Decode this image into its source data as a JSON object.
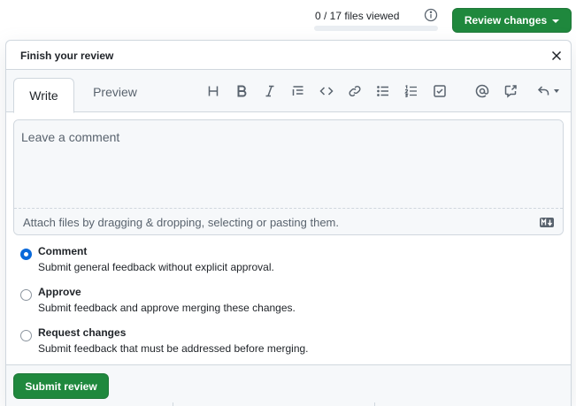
{
  "header": {
    "files_viewed": "0 / 17 files viewed",
    "files_viewed_fraction": 0.0,
    "review_button": "Review changes"
  },
  "panel": {
    "title": "Finish your review",
    "tabs": [
      {
        "label": "Write",
        "active": true
      },
      {
        "label": "Preview",
        "active": false
      }
    ],
    "toolbar_icons": [
      "heading-icon",
      "bold-icon",
      "italic-icon",
      "quote-icon",
      "code-icon",
      "link-icon",
      "bulleted-list-icon",
      "numbered-list-icon",
      "task-list-icon",
      "mention-icon",
      "cross-reference-icon",
      "saved-replies-icon"
    ],
    "comment": {
      "value": "",
      "placeholder": "Leave a comment"
    },
    "attach_text": "Attach files by dragging & dropping, selecting or pasting them.",
    "options": [
      {
        "label": "Comment",
        "description": "Submit general feedback without explicit approval.",
        "checked": true
      },
      {
        "label": "Approve",
        "description": "Submit feedback and approve merging these changes.",
        "checked": false
      },
      {
        "label": "Request changes",
        "description": "Submit feedback that must be addressed before merging.",
        "checked": false
      }
    ],
    "submit_button": "Submit review"
  },
  "colors": {
    "primary_green": "#1f883d",
    "radio_blue": "#0969da",
    "border": "#d0d7de",
    "muted_text": "#59636e"
  }
}
